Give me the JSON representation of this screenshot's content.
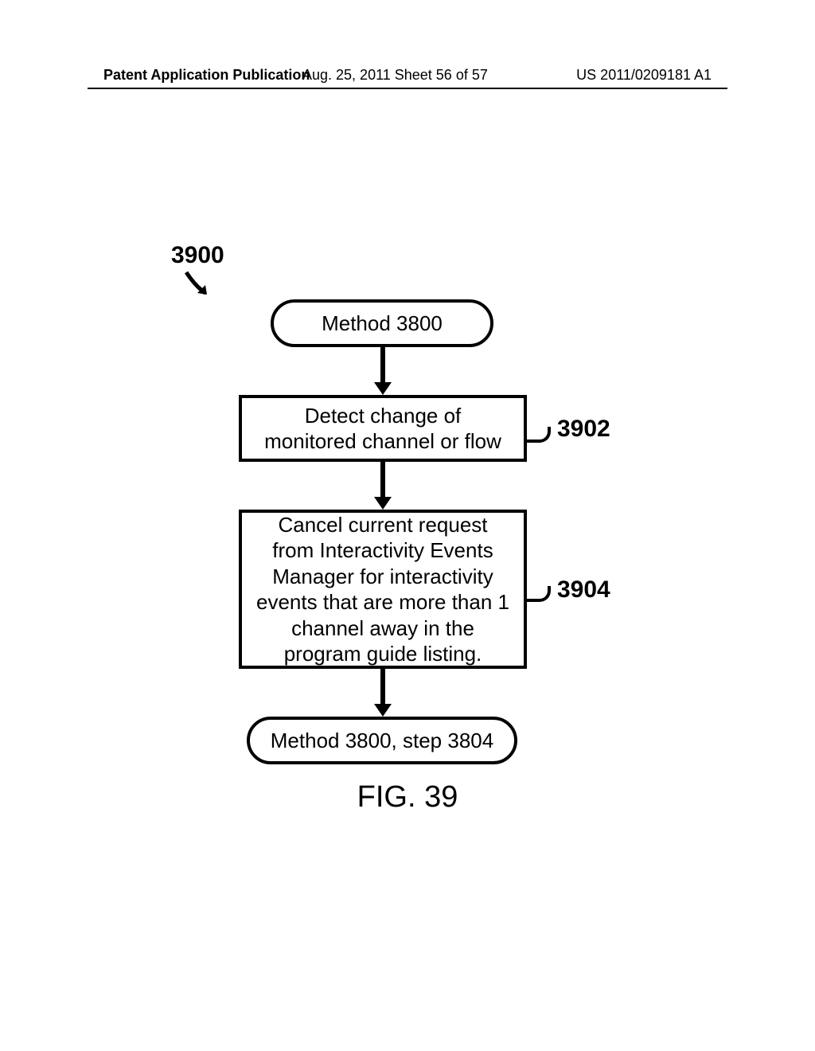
{
  "header": {
    "left": "Patent Application Publication",
    "center": "Aug. 25, 2011  Sheet 56 of 57",
    "right": "US 2011/0209181 A1"
  },
  "flow": {
    "ref_number": "3900",
    "start_label": "Method 3800",
    "step1_label": "Detect change of monitored channel or flow",
    "step1_ref": "3902",
    "step2_label": "Cancel current request from Interactivity Events Manager for interactivity events that are more than 1 channel away in the program guide listing.",
    "step2_ref": "3904",
    "end_label": "Method 3800, step 3804"
  },
  "figure_caption": "FIG. 39"
}
